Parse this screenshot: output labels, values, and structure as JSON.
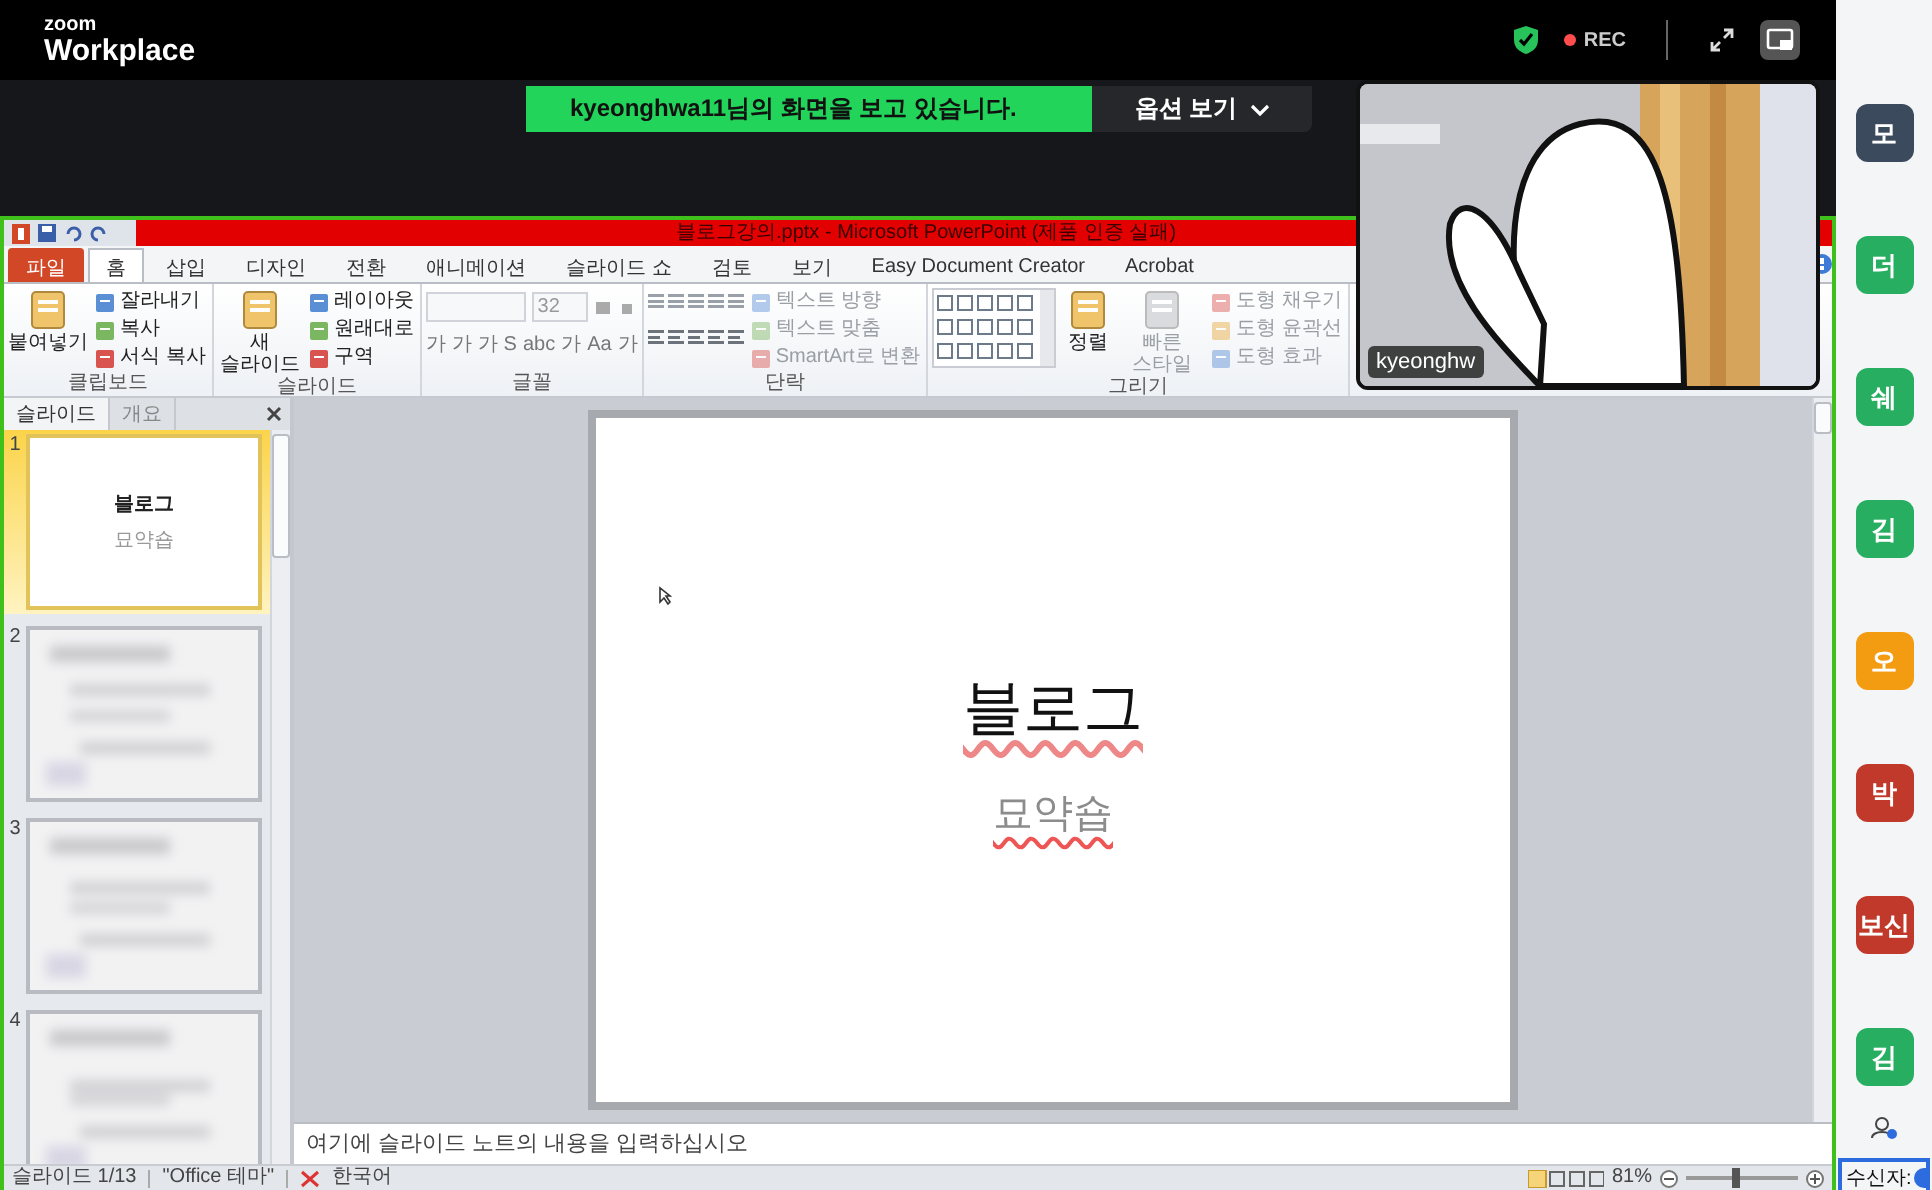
{
  "zoom_bar": {
    "brand_small": "zoom",
    "brand": "Workplace",
    "rec": "REC"
  },
  "share_banner": {
    "text": "kyeonghwa11님의 화면을 보고 있습니다.",
    "options": "옵션 보기"
  },
  "video_tile": {
    "name": "kyeonghw"
  },
  "powerpoint": {
    "title": "블로그강의.pptx - Microsoft PowerPoint (제품 인증 실패)",
    "tabs": [
      {
        "label": "파일",
        "kind": "file",
        "selected": false
      },
      {
        "label": "홈",
        "kind": "tab",
        "selected": true
      },
      {
        "label": "삽입",
        "kind": "tab",
        "selected": false
      },
      {
        "label": "디자인",
        "kind": "tab",
        "selected": false
      },
      {
        "label": "전환",
        "kind": "tab",
        "selected": false
      },
      {
        "label": "애니메이션",
        "kind": "tab",
        "selected": false
      },
      {
        "label": "슬라이드 쇼",
        "kind": "tab",
        "selected": false
      },
      {
        "label": "검토",
        "kind": "tab",
        "selected": false
      },
      {
        "label": "보기",
        "kind": "tab",
        "selected": false
      },
      {
        "label": "Easy Document Creator",
        "kind": "tab",
        "selected": false
      },
      {
        "label": "Acrobat",
        "kind": "tab",
        "selected": false
      }
    ],
    "ribbon_groups": [
      {
        "title": "클립보드",
        "items": [
          {
            "kind": "large",
            "label": "붙여넣기",
            "disabled": false
          },
          {
            "kind": "small",
            "label": "잘라내기",
            "disabled": false
          },
          {
            "kind": "small",
            "label": "복사",
            "disabled": false
          },
          {
            "kind": "small",
            "label": "서식 복사",
            "disabled": false
          }
        ]
      },
      {
        "title": "슬라이드",
        "items": [
          {
            "kind": "large",
            "label": "새 슬라이드",
            "disabled": false
          },
          {
            "kind": "small",
            "label": "레이아웃",
            "disabled": false
          },
          {
            "kind": "small",
            "label": "원래대로",
            "disabled": false
          },
          {
            "kind": "small",
            "label": "구역",
            "disabled": false
          }
        ]
      },
      {
        "title": "글꼴",
        "items": [
          {
            "kind": "font_controls",
            "size": "32",
            "glyphs": [
              "가",
              "가",
              "가",
              "S",
              "abc",
              "가",
              "Aa",
              "가"
            ]
          }
        ]
      },
      {
        "title": "단락",
        "items": [
          {
            "kind": "paragraph_controls"
          },
          {
            "kind": "small",
            "label": "텍스트 방향",
            "disabled": true
          },
          {
            "kind": "small",
            "label": "텍스트 맞춤",
            "disabled": true
          },
          {
            "kind": "small",
            "label": "SmartArt로 변환",
            "disabled": true
          }
        ]
      },
      {
        "title": "그리기",
        "items": [
          {
            "kind": "shape_gallery"
          },
          {
            "kind": "large",
            "label": "정렬",
            "disabled": false
          },
          {
            "kind": "large",
            "label": "빠른 스타일",
            "disabled": true
          },
          {
            "kind": "small",
            "label": "도형 채우기",
            "disabled": true
          },
          {
            "kind": "small",
            "label": "도형 윤곽선",
            "disabled": true
          },
          {
            "kind": "small",
            "label": "도형 효과",
            "disabled": true
          }
        ]
      }
    ],
    "slide_panel": {
      "tabs": [
        {
          "label": "슬라이드",
          "selected": true
        },
        {
          "label": "개요",
          "selected": false
        }
      ],
      "thumbnails": [
        {
          "number": "1",
          "selected": true,
          "title": "블로그",
          "subtitle": "묘약숍"
        },
        {
          "number": "2",
          "selected": false
        },
        {
          "number": "3",
          "selected": false
        },
        {
          "number": "4",
          "selected": false
        }
      ]
    },
    "slide": {
      "title": "블로그",
      "subtitle": "묘약숍"
    },
    "notes": {
      "placeholder": "여기에 슬라이드 노트의 내용을 입력하십시오"
    },
    "status_bar": {
      "slide": "슬라이드 1/13",
      "theme": "\"Office 테마\"",
      "language": "한국어",
      "zoom": "81%",
      "level": 0.45
    }
  },
  "participants": [
    {
      "initial": "모",
      "color": "#3b4a5c"
    },
    {
      "initial": "더",
      "color": "#27ae60"
    },
    {
      "initial": "쉐",
      "color": "#27ae60"
    },
    {
      "initial": "김",
      "color": "#27ae60"
    },
    {
      "initial": "오",
      "color": "#f39c12"
    },
    {
      "initial": "박",
      "color": "#c0392b"
    },
    {
      "initial": "보신",
      "color": "#c0392b"
    },
    {
      "initial": "김",
      "color": "#27ae60"
    }
  ],
  "chat": {
    "recipient_label": "수신자:"
  }
}
